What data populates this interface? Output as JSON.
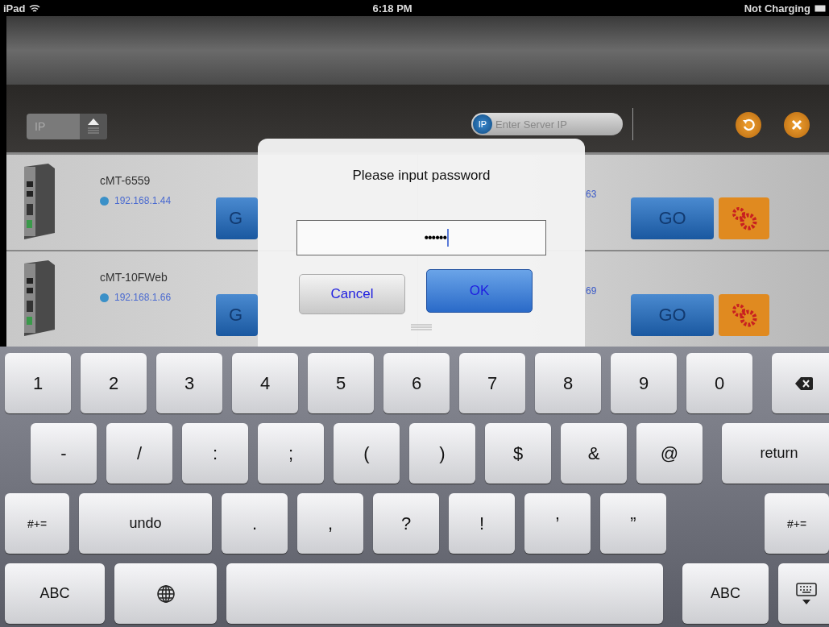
{
  "status_bar": {
    "device": "iPad",
    "time": "6:18 PM",
    "battery": "Not Charging"
  },
  "toolbar": {
    "mode_label": "IP",
    "server_field": {
      "icon_label": "IP",
      "placeholder": "Enter Server IP"
    }
  },
  "devices": [
    {
      "left": {
        "name": "cMT-6559",
        "ip": "192.168.1.44",
        "go": "G"
      },
      "right": {
        "ip_fragment": "63",
        "go": "GO"
      }
    },
    {
      "left": {
        "name": "cMT-10FWeb",
        "ip": "192.168.1.66",
        "go": "G"
      },
      "right": {
        "ip_fragment": "69",
        "go": "GO"
      }
    }
  ],
  "dialog": {
    "title": "Please input password",
    "password": "••••••",
    "buttons": [
      {
        "label": "Cancel",
        "kind": "cancel"
      },
      {
        "label": "OK",
        "kind": "default"
      }
    ]
  },
  "keyboard": [
    {
      "keys": [
        {
          "label": "1",
          "kind": "char"
        },
        {
          "label": "2",
          "kind": "char"
        },
        {
          "label": "3",
          "kind": "char"
        },
        {
          "label": "4",
          "kind": "char"
        },
        {
          "label": "5",
          "kind": "char"
        },
        {
          "label": "6",
          "kind": "char"
        },
        {
          "label": "7",
          "kind": "char"
        },
        {
          "label": "8",
          "kind": "char"
        },
        {
          "label": "9",
          "kind": "char"
        },
        {
          "label": "0",
          "kind": "char"
        }
      ],
      "right_keys": [
        {
          "kind": "backspace"
        }
      ]
    },
    {
      "keys": [
        {
          "label": "-",
          "kind": "char"
        },
        {
          "label": "/",
          "kind": "char"
        },
        {
          "label": ":",
          "kind": "char"
        },
        {
          "label": ";",
          "kind": "char"
        },
        {
          "label": "(",
          "kind": "char"
        },
        {
          "label": ")",
          "kind": "char"
        },
        {
          "label": "$",
          "kind": "char"
        },
        {
          "label": "&",
          "kind": "char"
        },
        {
          "label": "@",
          "kind": "char"
        }
      ],
      "right_keys": [
        {
          "label": "return",
          "kind": "return"
        }
      ]
    },
    {
      "keys": [
        {
          "label": "#+=",
          "kind": "symbols"
        },
        {
          "label": "undo",
          "kind": "undo"
        },
        {
          "label": ".",
          "kind": "char"
        },
        {
          "label": ",",
          "kind": "char"
        },
        {
          "label": "?",
          "kind": "char"
        },
        {
          "label": "!",
          "kind": "char"
        },
        {
          "label": "’",
          "kind": "char"
        },
        {
          "label": "”",
          "kind": "char"
        }
      ],
      "right_keys": [
        {
          "label": "#+=",
          "kind": "symbols"
        }
      ]
    },
    {
      "keys": [
        {
          "label": "ABC",
          "kind": "abc"
        },
        {
          "kind": "globe"
        },
        {
          "kind": "space"
        }
      ],
      "right_keys": [
        {
          "label": "ABC",
          "kind": "abc2"
        },
        {
          "kind": "hide"
        }
      ]
    }
  ]
}
